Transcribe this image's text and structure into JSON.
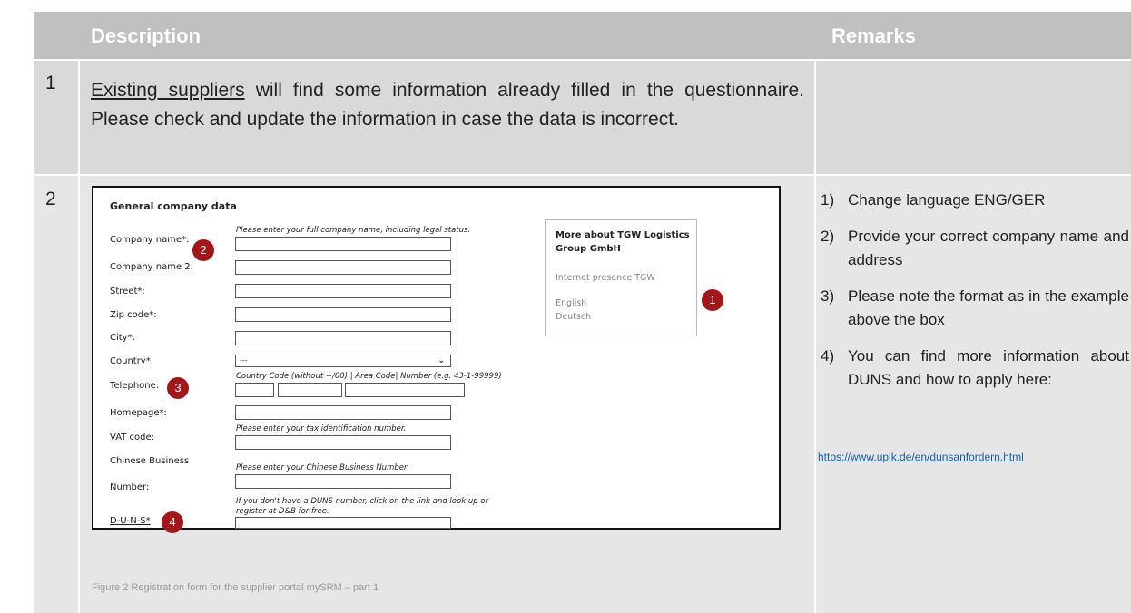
{
  "header": {
    "description": "Description",
    "remarks": "Remarks"
  },
  "row1": {
    "number": "1",
    "text_underlined": "Existing suppliers",
    "text_rest": " will find some information already filled in the questionnaire. Please check and update the information in case the data is incorrect."
  },
  "row2": {
    "number": "2",
    "caption": "Figure 2 Registration form for the supplier portal mySRM – part 1",
    "remarks": [
      {
        "n": "1)",
        "text": "Change language ENG/GER"
      },
      {
        "n": "2)",
        "text": "Provide your correct company name and address"
      },
      {
        "n": "3)",
        "text": "Please note the format as in the example above the box"
      },
      {
        "n": "4)",
        "text": "You can find more information about DUNS and how to apply here:"
      }
    ],
    "link": "https://www.upik.de/en/dunsanfordern.html"
  },
  "form": {
    "title": "General company data",
    "company_name_label": "Company name*:",
    "company_name_hint": "Please enter your full company name, including legal status.",
    "company_name2_label": "Company name 2:",
    "street_label": "Street*:",
    "zip_label": "Zip code*:",
    "city_label": "City*:",
    "country_label": "Country*:",
    "country_value": "---",
    "telephone_label": "Telephone:",
    "telephone_hint": "Country Code (without +/00) | Area Code| Number (e.g. 43-1-99999)",
    "homepage_label": "Homepage*:",
    "vat_label": "VAT code:",
    "vat_hint": "Please enter your tax identification number.",
    "chinese_label_1": "Chinese Business",
    "chinese_label_2": "Number:",
    "chinese_hint": "Please enter your Chinese Business Number",
    "duns_label": "D-U-N-S*",
    "duns_hint_1": "If you don't have a DUNS number, click on the link and look up or",
    "duns_hint_2": "register at D&B for free.",
    "side_title_1": "More about TGW Logistics",
    "side_title_2": "Group GmbH",
    "side_link_internet": "Internet presence TGW",
    "side_link_english": "English",
    "side_link_deutsch": "Deutsch"
  },
  "badges": [
    "1",
    "2",
    "3",
    "4"
  ],
  "colors": {
    "header_bg": "#c0c0c0",
    "row_bg": "#e6e6e6",
    "badge": "#a4161a",
    "link": "#1a5fa8"
  }
}
